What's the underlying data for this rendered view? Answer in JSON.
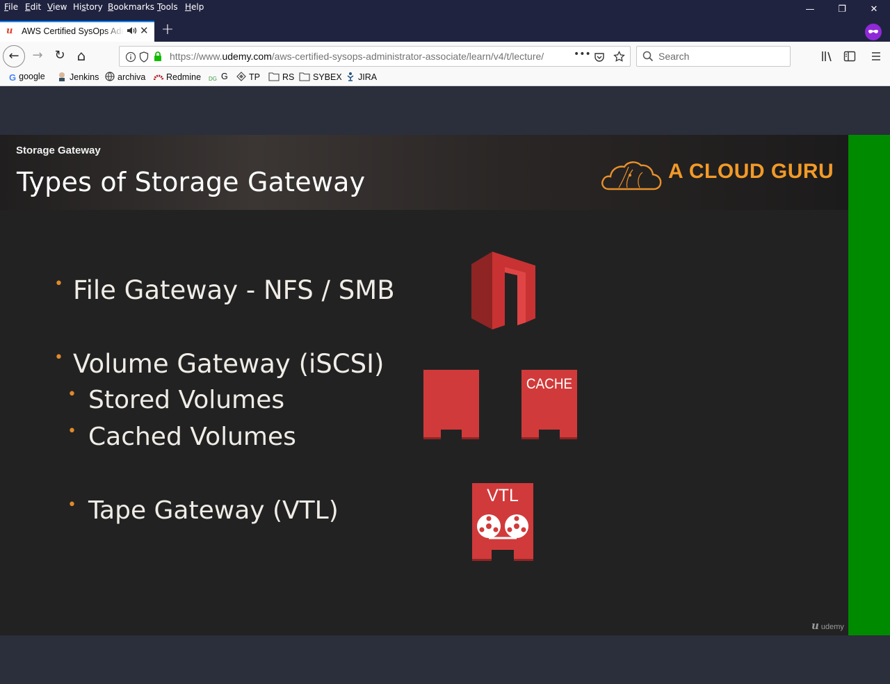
{
  "menu": {
    "items": [
      "File",
      "Edit",
      "View",
      "History",
      "Bookmarks",
      "Tools",
      "Help"
    ],
    "accel": [
      "F",
      "E",
      "V",
      "s",
      "B",
      "T",
      "H"
    ]
  },
  "window": {
    "minimize": "—",
    "restore": "❐",
    "close": "✕"
  },
  "tab": {
    "title": "AWS Certified SysOps Administrator - Associate",
    "favicon": "udemy-icon",
    "new_tab": "+"
  },
  "nav": {
    "back": "←",
    "forward": "→",
    "reload": "↻",
    "home": "⌂",
    "url_prefix": "https://www.",
    "url_domain": "udemy.com",
    "url_path": "/aws-certified-sysops-administrator-associate/learn/v4/t/lecture/",
    "page_actions": "•••",
    "search_placeholder": "Search"
  },
  "bookmarks": [
    {
      "label": "google",
      "icon": "google-icon"
    },
    {
      "label": "Jenkins",
      "icon": "jenkins-icon"
    },
    {
      "label": "archiva",
      "icon": "globe-icon"
    },
    {
      "label": "Redmine",
      "icon": "redmine-icon"
    },
    {
      "label": "G",
      "icon": "dg-icon"
    },
    {
      "label": "TP",
      "icon": "tp-icon"
    },
    {
      "label": "RS",
      "icon": "folder-icon"
    },
    {
      "label": "SYBEX",
      "icon": "folder-icon"
    },
    {
      "label": "JIRA",
      "icon": "jira-icon"
    }
  ],
  "slide": {
    "kicker": "Storage Gateway",
    "title": "Types of Storage Gateway",
    "brand": "A CLOUD GURU",
    "bullets": [
      {
        "text": "File Gateway - NFS / SMB",
        "level": 1
      },
      {
        "text": "Volume Gateway (iSCSI)",
        "level": 1
      },
      {
        "text": "Stored Volumes",
        "level": 2
      },
      {
        "text": "Cached Volumes",
        "level": 2
      },
      {
        "text": "Tape Gateway (VTL)",
        "level": 2
      }
    ],
    "cache_label": "CACHE",
    "vtl_label": "VTL",
    "watermark": "udemy",
    "accent_color": "#e08a2a",
    "icon_color": "#d13a3a"
  }
}
